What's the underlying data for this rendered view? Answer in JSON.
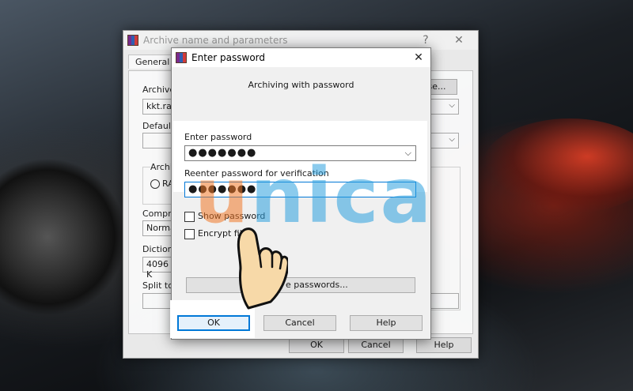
{
  "background_dialog": {
    "title": "Archive name and parameters",
    "help_glyph": "?",
    "close_glyph": "✕",
    "tab_general": "General",
    "archive_label": "Archive",
    "archive_value": "kkt.rar",
    "browse_label": "se...",
    "default_label": "Default",
    "archive_format_label": "Archi",
    "radio_label": "RA",
    "compression_label": "Compre",
    "compression_value": "Norma",
    "dictionary_label": "Dictiona",
    "dictionary_value": "4096 K",
    "split_label": "Split to",
    "ok": "OK",
    "cancel": "Cancel",
    "help": "Help"
  },
  "password_dialog": {
    "title": "Enter password",
    "close_glyph": "✕",
    "subtitle": "Archiving with password",
    "enter_label": "Enter password",
    "enter_value": "●●●●●●●",
    "reenter_label": "Reenter password for verification",
    "reenter_value": "●●●●●●●",
    "show_password": "Show password",
    "encrypt_file_names": "Encrypt file n",
    "organize_button": "e passwords...",
    "ok": "OK",
    "cancel": "Cancel",
    "help": "Help"
  },
  "watermark": {
    "text_u": "u",
    "text_rest": "nica"
  },
  "colors": {
    "accent": "#0078d7",
    "watermark_blue": "#2ca0de",
    "watermark_orange": "#f07828"
  }
}
